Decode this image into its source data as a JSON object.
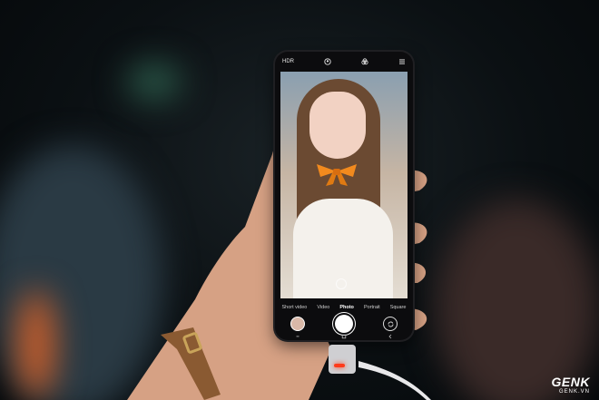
{
  "scene": {
    "description_free": true
  },
  "camera_ui": {
    "status_bar": {
      "hdr_label": "HDR",
      "icons": [
        "face-beauty-icon",
        "filter-icon",
        "menu-icon"
      ]
    },
    "modes": [
      "Short video",
      "Video",
      "Photo",
      "Portrait",
      "Square"
    ],
    "active_mode": "Photo",
    "controls": [
      "gallery-thumbnail",
      "shutter-button",
      "switch-camera-icon"
    ],
    "nav_buttons": [
      "recent-apps-icon",
      "home-icon",
      "back-icon"
    ]
  },
  "watermark": {
    "brand": "GENK",
    "site": "GENK.VN"
  },
  "colors": {
    "bow": "#f28a1e",
    "led": "#ff3a1a",
    "strap": "#8a5a32"
  }
}
